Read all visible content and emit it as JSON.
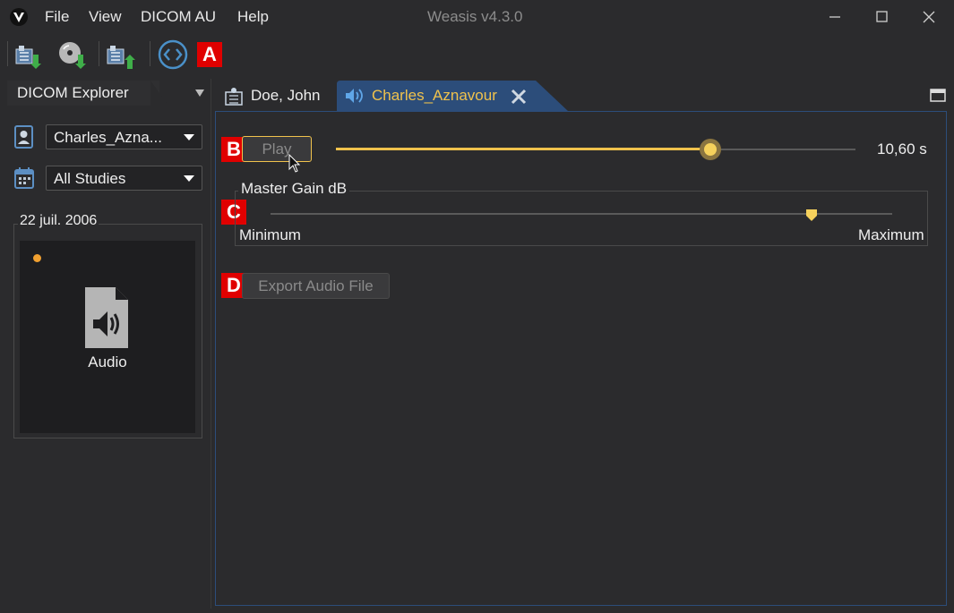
{
  "app": {
    "title": "Weasis v4.3.0"
  },
  "menu": {
    "file": "File",
    "view": "View",
    "dicom_au": "DICOM AU",
    "help": "Help"
  },
  "icons": {
    "app_logo": "weasis-logo-icon",
    "import_dicom": "import-dicom-icon",
    "import_cd": "import-cd-icon",
    "export_dicom": "export-dicom-icon",
    "viewer_switch": "code-brackets-icon"
  },
  "annotations": {
    "a": "A",
    "b": "B",
    "c": "C",
    "d": "D"
  },
  "explorer": {
    "title": "DICOM Explorer",
    "patient_value": "Charles_Azna...",
    "study_value": "All Studies",
    "study_date": "22 juil. 2006",
    "thumbnail_label": "Audio"
  },
  "tabs": [
    {
      "label": "Doe, John"
    },
    {
      "label": "Charles_Aznavour"
    }
  ],
  "audio": {
    "play_label": "Play",
    "time_value": "10,60 s",
    "time_progress": 0.72,
    "gain_title": "Master Gain dB",
    "gain_min_label": "Minimum",
    "gain_max_label": "Maximum",
    "gain_level": 0.87,
    "export_label": "Export Audio File"
  },
  "colors": {
    "accent": "#f0c24c",
    "tab_active_bg": "#2c4d7a",
    "annotation": "#e00000"
  }
}
